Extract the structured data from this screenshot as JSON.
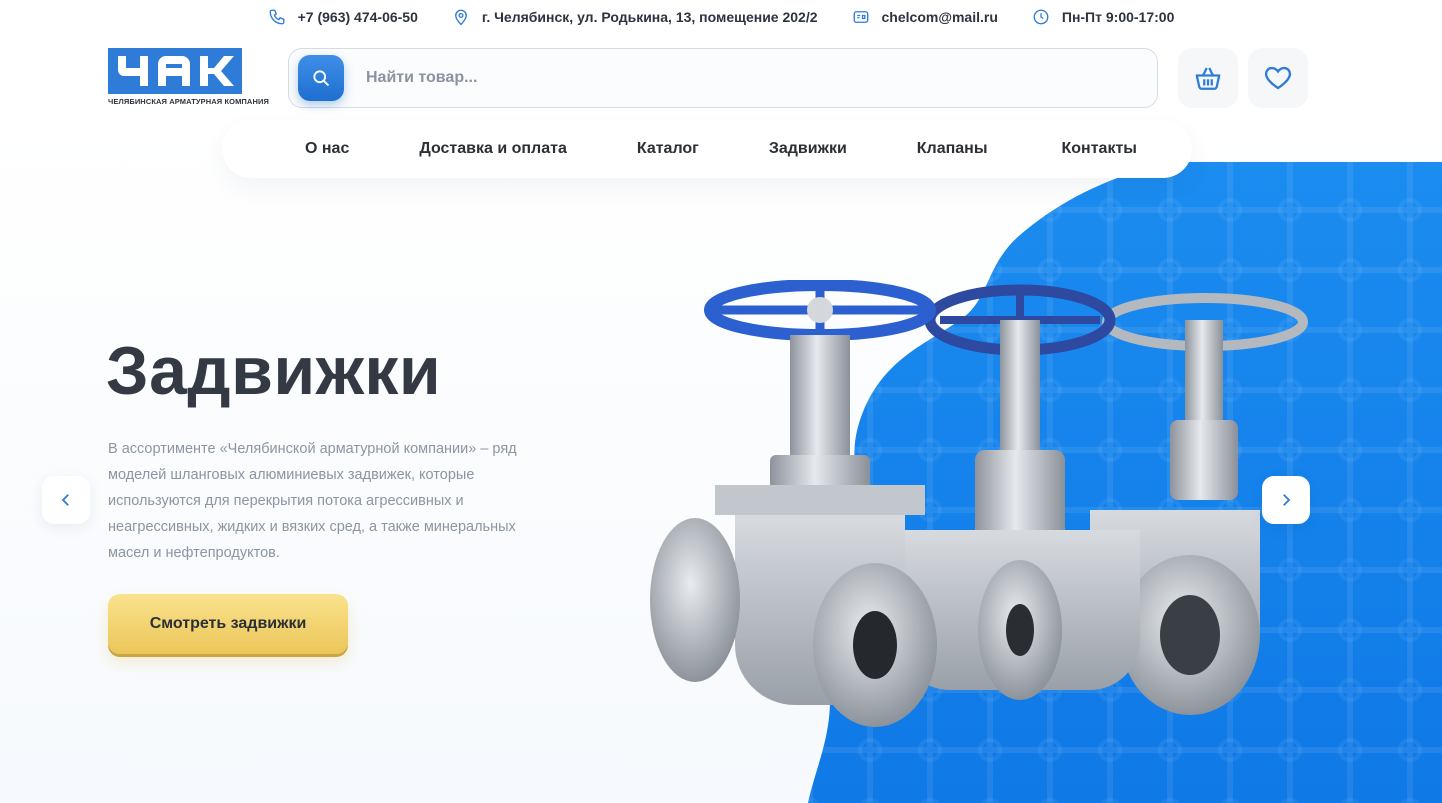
{
  "topbar": {
    "phone": "+7 (963) 474-06-50",
    "address": "г. Челябинск, ул. Родькина, 13, помещение 202/2",
    "email": "chelcom@mail.ru",
    "hours": "Пн-Пт 9:00-17:00"
  },
  "logo": {
    "mark_text": "ЧАК",
    "caption": "Челябинская арматурная компания"
  },
  "search": {
    "placeholder": "Найти товар..."
  },
  "header_icons": [
    "cart-icon",
    "heart-icon"
  ],
  "nav": {
    "items": [
      {
        "label": "О нас"
      },
      {
        "label": "Доставка и оплата"
      },
      {
        "label": "Каталог"
      },
      {
        "label": "Задвижки"
      },
      {
        "label": "Клапаны"
      },
      {
        "label": "Контакты"
      }
    ]
  },
  "hero": {
    "title": "Задвижки",
    "description": "В ассортименте «Челябинской арматурной компании» – ряд моделей шланговых алюминиевых задвижек, которые используются для перекрытия потока агрессивных и неагрессивных, жидких и вязких сред, а также минеральных масел и нефтепродуктов.",
    "cta_label": "Смотреть задвижки"
  },
  "colors": {
    "accent_blue": "#2f7bd8",
    "cta_yellow": "#f1d06f",
    "text_dark": "#343a44",
    "text_muted": "#8c95a3"
  }
}
